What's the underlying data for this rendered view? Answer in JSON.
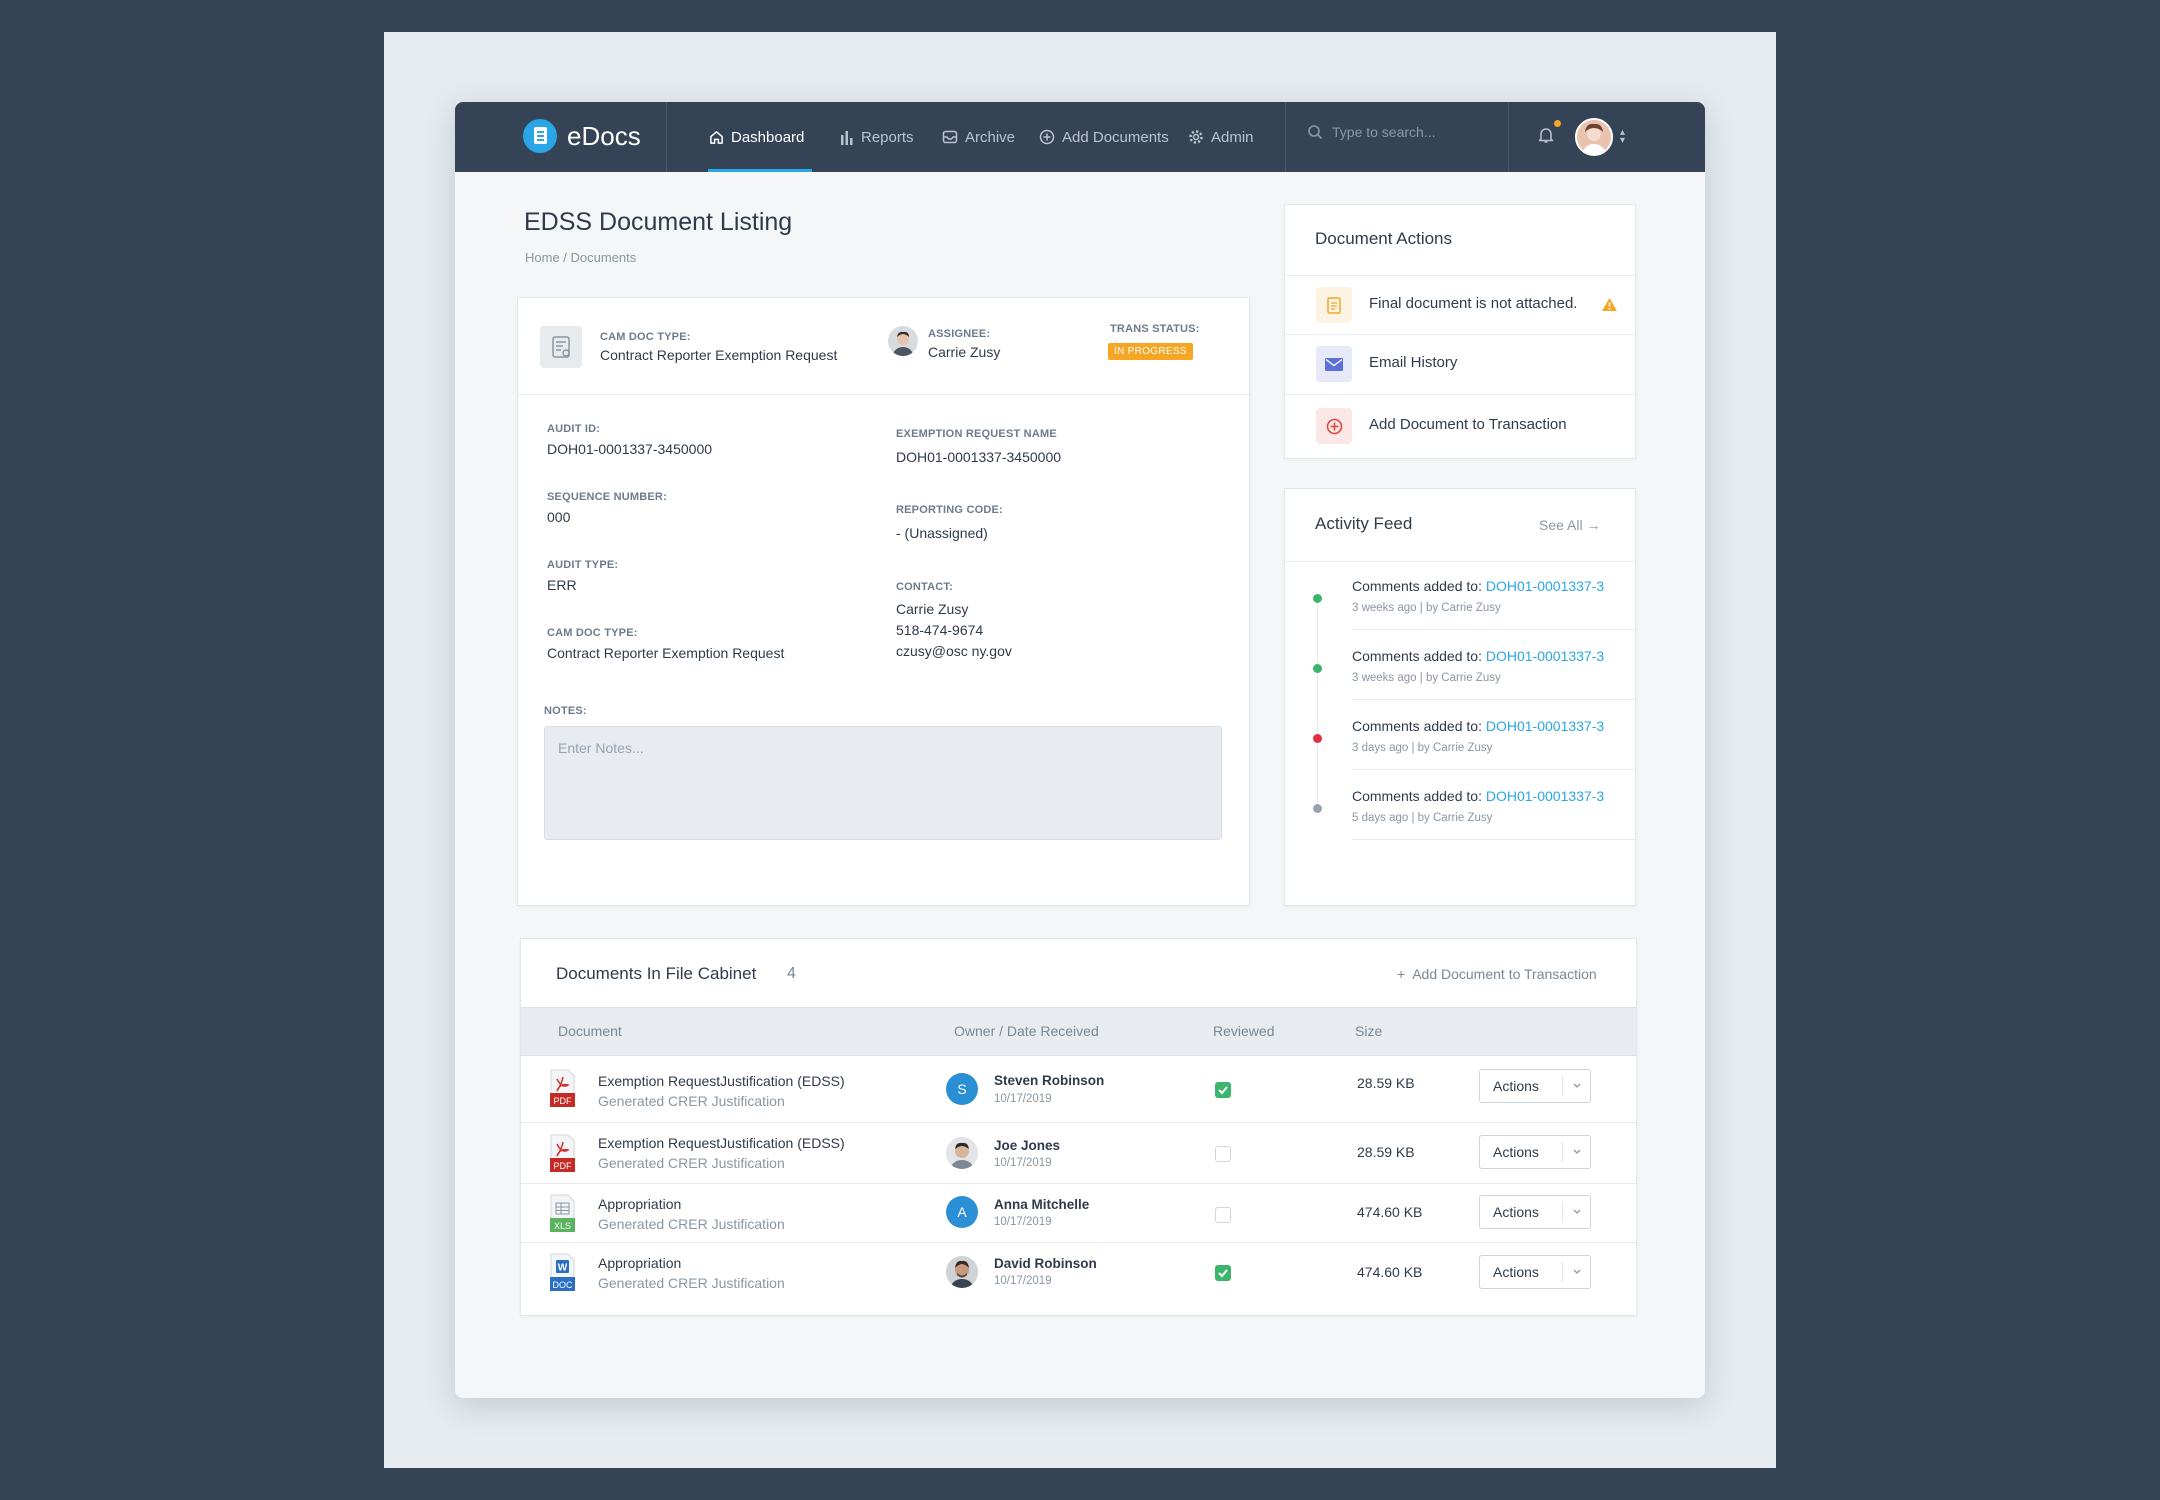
{
  "app": {
    "name": "eDocs"
  },
  "nav": {
    "items": [
      {
        "label": "Dashboard",
        "icon": "home-icon",
        "active": true
      },
      {
        "label": "Reports",
        "icon": "bar-chart-icon"
      },
      {
        "label": "Archive",
        "icon": "inbox-icon"
      },
      {
        "label": "Add Documents",
        "icon": "plus-circle-icon"
      },
      {
        "label": "Admin",
        "icon": "gear-icon"
      }
    ],
    "search_placeholder": "Type to search..."
  },
  "page": {
    "title": "EDSS Document Listing",
    "breadcrumb": "Home / Documents"
  },
  "detail": {
    "cam_doc_type_label": "CAM DOC TYPE:",
    "cam_doc_type_value": "Contract Reporter Exemption Request",
    "assignee_label": "ASSIGNEE:",
    "assignee_value": "Carrie Zusy",
    "trans_status_label": "TRANS STATUS:",
    "trans_status_value": "IN PROGRESS",
    "fields_left": [
      {
        "label": "AUDIT ID:",
        "value": "DOH01-0001337-3450000"
      },
      {
        "label": "SEQUENCE NUMBER:",
        "value": "000"
      },
      {
        "label": "AUDIT TYPE:",
        "value": "ERR"
      },
      {
        "label": "CAM DOC TYPE:",
        "value": "Contract Reporter Exemption Request"
      }
    ],
    "fields_right": [
      {
        "label": "EXEMPTION REQUEST NAME",
        "value": "DOH01-0001337-3450000"
      },
      {
        "label": "REPORTING CODE:",
        "value": "- (Unassigned)"
      }
    ],
    "contact": {
      "label": "CONTACT:",
      "name": "Carrie Zusy",
      "phone": "518-474-9674",
      "email": "czusy@osc ny.gov"
    },
    "notes_label": "NOTES:",
    "notes_placeholder": "Enter Notes..."
  },
  "doc_actions": {
    "title": "Document Actions",
    "items": [
      {
        "label": "Final document is not attached.",
        "icon": "document-icon"
      },
      {
        "label": "Email History",
        "icon": "envelope-icon"
      },
      {
        "label": "Add Document to Transaction",
        "icon": "plus-circle-icon"
      }
    ]
  },
  "activity": {
    "title": "Activity Feed",
    "see_all": "See All",
    "items": [
      {
        "text": "Comments added to:",
        "link": "DOH01-0001337-3",
        "time": "3 weeks ago",
        "by": "by Carrie Zusy",
        "color": "#3ab56b"
      },
      {
        "text": "Comments added to:",
        "link": "DOH01-0001337-3",
        "time": "3 weeks ago",
        "by": "by Carrie Zusy",
        "color": "#3ab56b"
      },
      {
        "text": "Comments added to:",
        "link": "DOH01-0001337-3",
        "time": "3 days ago",
        "by": "by Carrie Zusy",
        "color": "#e0303f"
      },
      {
        "text": "Comments added to:",
        "link": "DOH01-0001337-3",
        "time": "5 days ago",
        "by": "by Carrie Zusy",
        "color": "#9aa3ad"
      }
    ]
  },
  "cabinet": {
    "title": "Documents In File Cabinet",
    "count": "4",
    "add_label": "Add Document to Transaction",
    "headers": {
      "document": "Document",
      "owner": "Owner / Date Received",
      "reviewed": "Reviewed",
      "size": "Size"
    },
    "rows": [
      {
        "name": "Exemption RequestJustification (EDSS)",
        "sub": "Generated CRER Justification",
        "type": "PDF",
        "owner": "Steven Robinson",
        "initial": "S",
        "date": "10/17/2019",
        "reviewed": true,
        "size": "28.59 KB",
        "action": "Actions"
      },
      {
        "name": "Exemption RequestJustification (EDSS)",
        "sub": "Generated CRER Justification",
        "type": "PDF",
        "owner": "Joe Jones",
        "initial": "",
        "date": "10/17/2019",
        "reviewed": false,
        "size": "28.59 KB",
        "action": "Actions"
      },
      {
        "name": "Appropriation",
        "sub": "Generated CRER Justification",
        "type": "XLS",
        "owner": "Anna Mitchelle",
        "initial": "A",
        "date": "10/17/2019",
        "reviewed": false,
        "size": "474.60 KB",
        "action": "Actions"
      },
      {
        "name": "Appropriation",
        "sub": "Generated CRER Justification",
        "type": "DOC",
        "owner": "David Robinson",
        "initial": "",
        "date": "10/17/2019",
        "reviewed": true,
        "size": "474.60 KB",
        "action": "Actions"
      }
    ]
  },
  "colors": {
    "accent": "#2aa6e6",
    "nav_bg": "#344456",
    "warning": "#f5a623",
    "success": "#3ab56b",
    "danger": "#e0303f"
  }
}
